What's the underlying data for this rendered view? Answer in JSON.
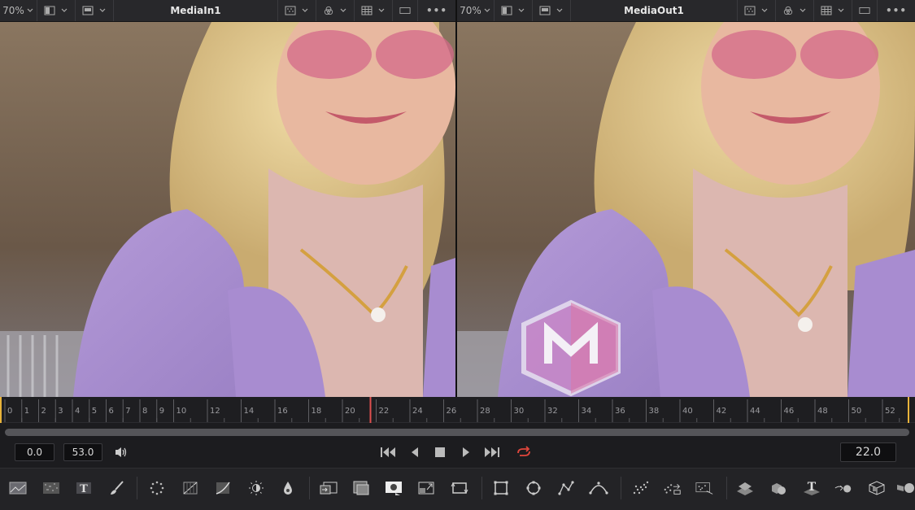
{
  "viewer_left": {
    "zoom": "70%",
    "title": "MediaIn1"
  },
  "viewer_right": {
    "zoom": "70%",
    "title": "MediaOut1"
  },
  "ruler": {
    "ticks": [
      "0",
      "1",
      "2",
      "3",
      "4",
      "5",
      "6",
      "7",
      "8",
      "9",
      "10",
      "12",
      "14",
      "16",
      "18",
      "20",
      "22",
      "24",
      "26",
      "28",
      "30",
      "32",
      "34",
      "36",
      "38",
      "40",
      "42",
      "44",
      "46",
      "48",
      "50",
      "52"
    ],
    "playhead": 22.0,
    "accent": "#e8b33a",
    "playhead_color": "#e05050"
  },
  "transport": {
    "render_start": "0.0",
    "render_end": "53.0",
    "current_time": "22.0",
    "loop_color": "#e0463c"
  },
  "toolbar": {
    "tools": [
      "background-tool-icon",
      "fast-noise-icon",
      "text-plus-icon",
      "paint-brush-icon",
      "particles-icon",
      "color-corrector-icon",
      "color-curves-icon",
      "brightness-contrast-icon",
      "color-drop-icon",
      "merge-icon",
      "channel-boolean-icon",
      "matte-control-icon",
      "resize-icon",
      "transform-icon",
      "rectangle-mask-icon",
      "ellipse-mask-icon",
      "polygon-mask-icon",
      "bspline-mask-icon",
      "pemitter-icon",
      "prender-icon",
      "pdirectional-force-icon",
      "shape3d-icon",
      "merge3d-icon",
      "text3d-icon",
      "render3d-icon",
      "camera3d-icon",
      "renderer3d-icon"
    ]
  }
}
